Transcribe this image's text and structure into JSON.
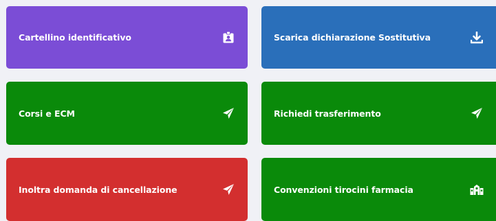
{
  "cards": [
    {
      "label": "Cartellino identificativo",
      "icon": "id-badge-icon",
      "color": "#7b4dd6"
    },
    {
      "label": "Scarica dichiarazione Sostitutiva",
      "icon": "download-icon",
      "color": "#2a6fba"
    },
    {
      "label": "Corsi e ECM",
      "icon": "paper-plane-icon",
      "color": "#0a8a0a"
    },
    {
      "label": "Richiedi trasferimento",
      "icon": "paper-plane-icon",
      "color": "#0a8a0a"
    },
    {
      "label": "Inoltra domanda di cancellazione",
      "icon": "paper-plane-icon",
      "color": "#d32f2f"
    },
    {
      "label": "Convenzioni tirocini farmacia",
      "icon": "school-icon",
      "color": "#0a8a0a"
    }
  ],
  "colors": {
    "background": "#f0f1f6",
    "purple": "#7b4dd6",
    "blue": "#2a6fba",
    "green": "#0a8a0a",
    "red": "#d32f2f",
    "text": "#ffffff"
  }
}
